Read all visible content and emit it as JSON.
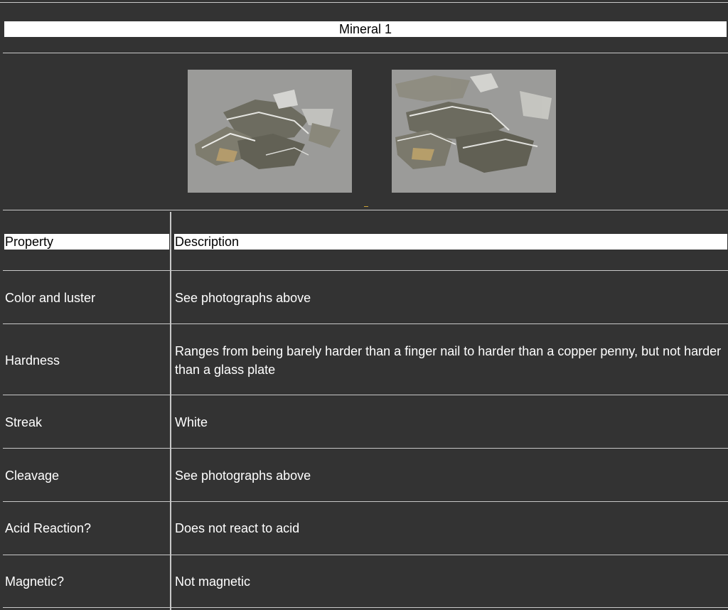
{
  "title": "Mineral 1",
  "photos": [
    {
      "name": "mineral-photo-left"
    },
    {
      "name": "mineral-photo-right"
    }
  ],
  "table": {
    "headers": {
      "property": "Property",
      "description": "Description"
    },
    "rows": [
      {
        "property": "Color and luster",
        "description": "See photographs above"
      },
      {
        "property": "Hardness",
        "description": "Ranges from being barely harder than a finger nail to harder than a copper penny, but not harder than a glass plate"
      },
      {
        "property": "Streak",
        "description": "White"
      },
      {
        "property": "Cleavage",
        "description": "See photographs above"
      },
      {
        "property": "Acid Reaction?",
        "description": "Does not react to acid"
      },
      {
        "property": "Magnetic?",
        "description": "Not magnetic"
      }
    ]
  }
}
